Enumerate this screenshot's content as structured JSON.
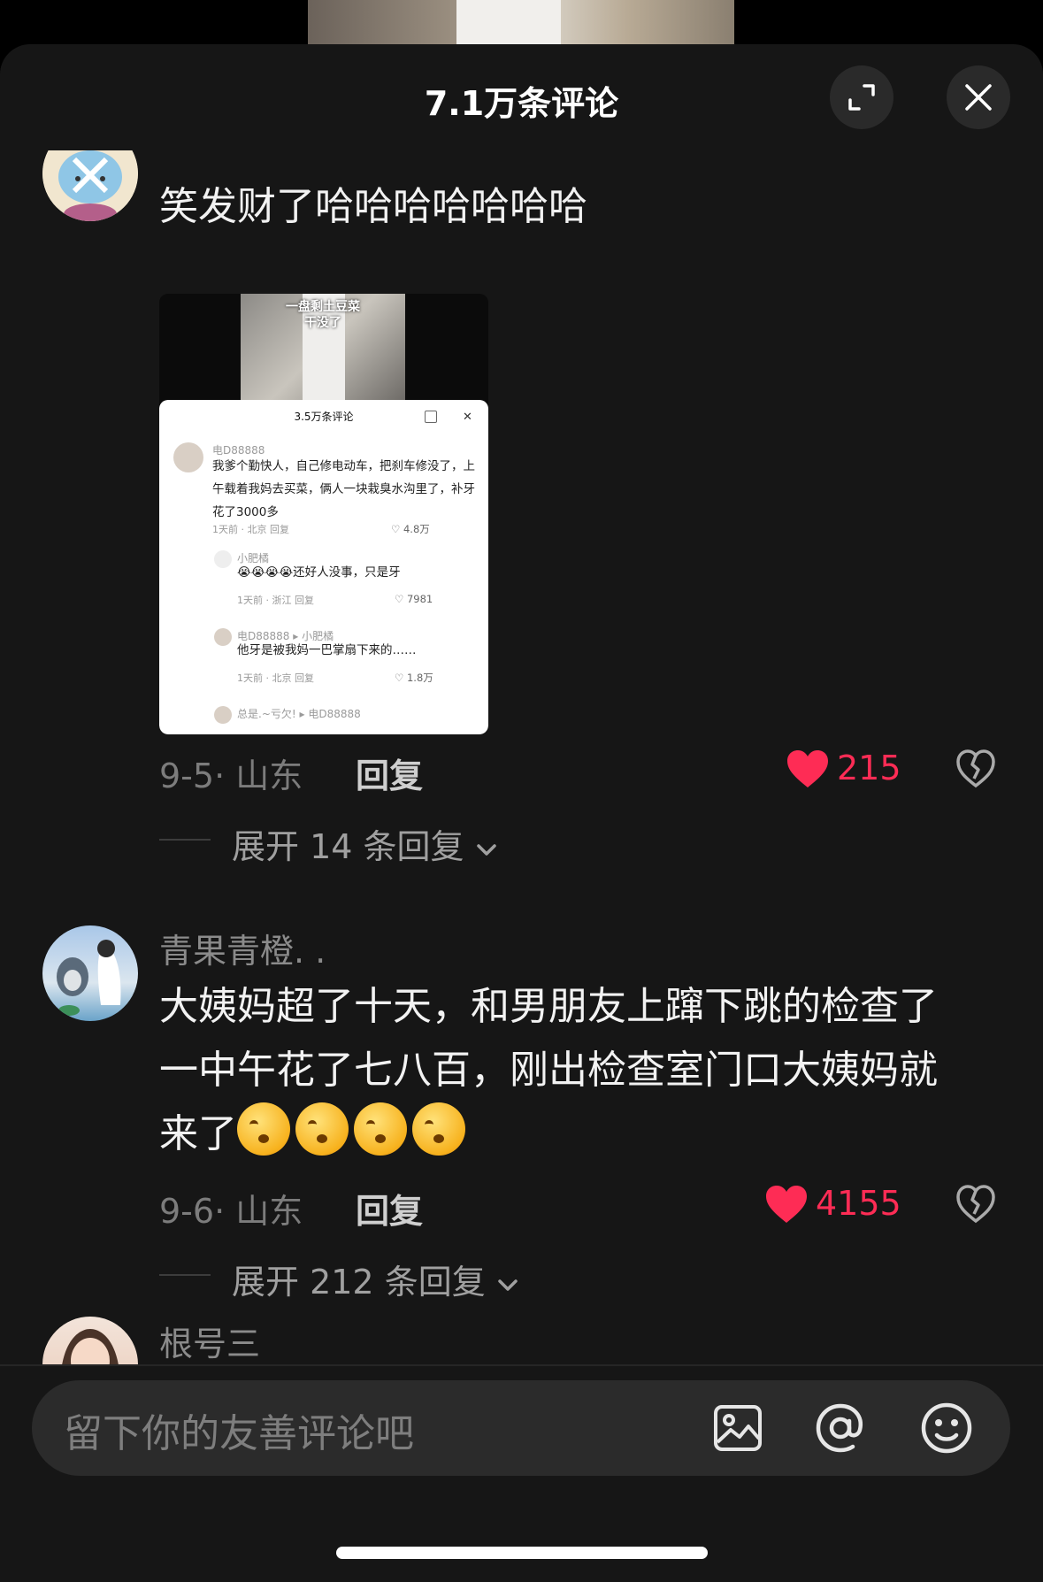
{
  "header": {
    "title": "7.1万条评论"
  },
  "comments": [
    {
      "username": "",
      "text": "笑发财了哈哈哈哈哈哈哈",
      "date": "9-5· 山东",
      "reply_label": "回复",
      "likes": "215",
      "expand_label": "展开 14 条回复",
      "screenshot": {
        "caption": "一盘剩土豆菜\n干没了",
        "title": "3.5万条评论",
        "items": [
          {
            "name": "电D88888",
            "text": "我爹个勤快人，自己修电动车，把刹车修没了，上午载着我妈去买菜，俩人一块栽臭水沟里了，补牙花了3000多",
            "meta": "1天前 · 北京    回复",
            "likes": "4.8万"
          },
          {
            "name": "小肥橘",
            "text": "还好人没事，只是牙",
            "meta": "1天前 · 浙江    回复",
            "likes": "7981"
          },
          {
            "name": "电D88888 ▸ 小肥橘",
            "text": "他牙是被我妈一巴掌扇下来的……",
            "meta": "1天前 · 北京    回复",
            "likes": "1.8万"
          },
          {
            "name": "总是.~亏欠! ▸ 电D88888",
            "text": "",
            "meta": "",
            "likes": ""
          }
        ]
      }
    },
    {
      "username": "青果青橙. .",
      "text": "大姨妈超了十天，和男朋友上蹿下跳的检查了一中午花了七八百，刚出检查室门口大姨妈就来了",
      "date": "9-6· 山东",
      "reply_label": "回复",
      "likes": "4155",
      "expand_label": "展开 212 条回复"
    },
    {
      "username": "根号三"
    }
  ],
  "input": {
    "placeholder": "留下你的友善评论吧"
  },
  "colors": {
    "like": "#fe2c55",
    "background": "#161616"
  },
  "icons": [
    "expand-icon",
    "close-icon",
    "heart-icon",
    "broken-heart-icon",
    "chevron-down-icon",
    "image-icon",
    "at-icon",
    "emoji-icon"
  ]
}
